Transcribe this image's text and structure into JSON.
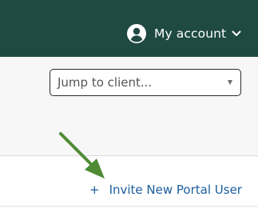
{
  "colors": {
    "header_bg": "#1f4a42",
    "link": "#1b5e9e",
    "annotation_arrow": "#4e8b34"
  },
  "header": {
    "account_label": "My account",
    "avatar_icon": "user-circle-icon",
    "chevron_icon": "chevron-down-icon"
  },
  "client_jump": {
    "placeholder": "Jump to client..."
  },
  "actions": {
    "invite_plus": "+",
    "invite_label": "Invite New Portal User"
  }
}
